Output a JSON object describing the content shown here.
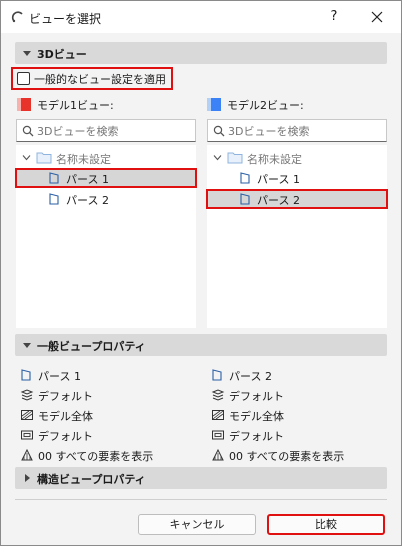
{
  "window": {
    "title": "ビューを選択",
    "help_label": "?"
  },
  "section_3d": {
    "label": "3Dビュー"
  },
  "apply_common": {
    "label": "一般的なビュー設定を適用",
    "checked": false
  },
  "model1": {
    "label": "モデル1ビュー:",
    "swatch_color": "#e8332a",
    "search_placeholder": "3Dビューを検索",
    "tree": {
      "folder": "名称未設定",
      "items": [
        "パース 1",
        "パース 2"
      ],
      "selected_index": 0
    }
  },
  "model2": {
    "label": "モデル2ビュー:",
    "swatch_color": "#3b82f6",
    "search_placeholder": "3Dビューを検索",
    "tree": {
      "folder": "名称未設定",
      "items": [
        "パース 1",
        "パース 2"
      ],
      "selected_index": 1
    }
  },
  "section_general": {
    "label": "一般ビュープロパティ"
  },
  "props_left": {
    "view": "パース 1",
    "layer": "デフォルト",
    "model": "モデル全体",
    "pen": "デフォルト",
    "elements": "00 すべての要素を表示"
  },
  "props_right": {
    "view": "パース 2",
    "layer": "デフォルト",
    "model": "モデル全体",
    "pen": "デフォルト",
    "elements": "00 すべての要素を表示"
  },
  "section_struct": {
    "label": "構造ビュープロパティ"
  },
  "buttons": {
    "cancel": "キャンセル",
    "compare": "比較"
  },
  "colors": {
    "highlight": "#e01010",
    "selected_row": "#d6d6d6"
  }
}
